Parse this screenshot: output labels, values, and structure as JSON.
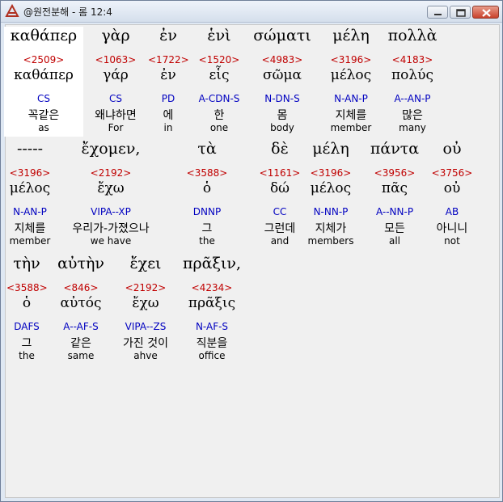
{
  "window": {
    "title": "@원전분해 - 롬 12:4"
  },
  "icons": {
    "app": "app-icon",
    "minimize": "minimize-icon",
    "maximize": "maximize-icon",
    "close": "close-icon"
  },
  "lines": [
    [
      {
        "greek": "καθάπερ",
        "strong": "<2509>",
        "lemma": "καθάπερ",
        "parse": "CS",
        "korean": "꼭같은",
        "english": "as"
      },
      {
        "greek": "γὰρ",
        "strong": "<1063>",
        "lemma": "γάρ",
        "parse": "CS",
        "korean": "왜냐하면",
        "english": "For"
      },
      {
        "greek": "ἐν",
        "strong": "<1722>",
        "lemma": "ἐν",
        "parse": "PD",
        "korean": "에",
        "english": "in"
      },
      {
        "greek": "ἑνὶ",
        "strong": "<1520>",
        "lemma": "εἷς",
        "parse": "A-CDN-S",
        "korean": "한",
        "english": "one"
      },
      {
        "greek": "σώματι",
        "strong": "<4983>",
        "lemma": "σῶμα",
        "parse": "N-DN-S",
        "korean": "몸",
        "english": "body"
      },
      {
        "greek": "μέλη",
        "strong": "<3196>",
        "lemma": "μέλος",
        "parse": "N-AN-P",
        "korean": "지체를",
        "english": "member"
      },
      {
        "greek": "πολλὰ",
        "strong": "<4183>",
        "lemma": "πολύς",
        "parse": "A--AN-P",
        "korean": "많은",
        "english": "many"
      }
    ],
    [
      {
        "greek": "-----",
        "strong": "<3196>",
        "lemma": "μέλος",
        "parse": "N-AN-P",
        "korean": "지체를",
        "english": "member"
      },
      {
        "greek": "ἔχομεν,",
        "strong": "<2192>",
        "lemma": "ἔχω",
        "parse": "VIPA--XP",
        "korean": "우리가-가졌으나",
        "english": "we have"
      },
      {
        "greek": "τὰ",
        "strong": "<3588>",
        "lemma": "ὁ",
        "parse": "DNNP",
        "korean": "그",
        "english": "the"
      },
      {
        "greek": "δὲ",
        "strong": "<1161>",
        "lemma": "δώ",
        "parse": "CC",
        "korean": "그런데",
        "english": "and"
      },
      {
        "greek": "μέλη",
        "strong": "<3196>",
        "lemma": "μέλος",
        "parse": "N-NN-P",
        "korean": "지체가",
        "english": "members"
      },
      {
        "greek": "πάντα",
        "strong": "<3956>",
        "lemma": "πᾶς",
        "parse": "A--NN-P",
        "korean": "모든",
        "english": "all"
      },
      {
        "greek": "οὐ",
        "strong": "<3756>",
        "lemma": "οὐ",
        "parse": "AB",
        "korean": "아니니",
        "english": "not"
      }
    ],
    [
      {
        "greek": "τὴν",
        "strong": "<3588>",
        "lemma": "ὁ",
        "parse": "DAFS",
        "korean": "그",
        "english": "the"
      },
      {
        "greek": "αὐτὴν",
        "strong": "<846>",
        "lemma": "αὐτός",
        "parse": "A--AF-S",
        "korean": "같은",
        "english": "same"
      },
      {
        "greek": "ἔχει",
        "strong": "<2192>",
        "lemma": "ἔχω",
        "parse": "VIPA--ZS",
        "korean": "가진 것이",
        "english": "ahve"
      },
      {
        "greek": "πρᾶξιν,",
        "strong": "<4234>",
        "lemma": "πρᾶξις",
        "parse": "N-AF-S",
        "korean": "직분을",
        "english": "office"
      }
    ]
  ]
}
